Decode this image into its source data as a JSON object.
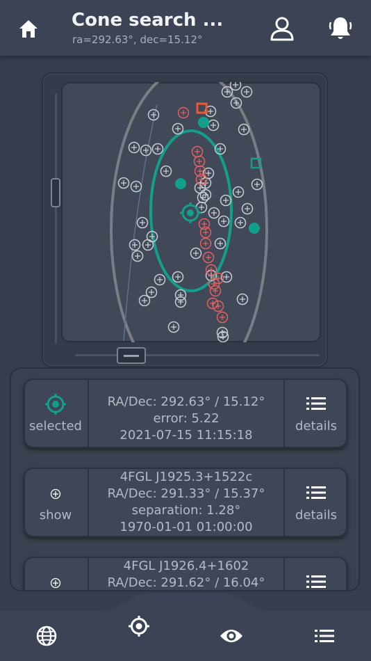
{
  "header": {
    "title": "Cone search ...",
    "subtitle": "ra=292.63°, dec=15.12°",
    "icons": [
      "home-icon",
      "user-icon",
      "bell-icon"
    ]
  },
  "colors": {
    "accent_teal": "#12a08d",
    "marker_red": "#e5605f",
    "marker_orange": "#f0582e",
    "marker_grey": "#c9ccd3",
    "background": "#363d4d"
  },
  "results": [
    {
      "left_label": "selected",
      "left_icon": "target-icon",
      "lines": [
        "RA/Dec: 292.63° / 15.12°",
        "error: 5.22",
        "2021-07-15  11:15:18"
      ],
      "right_label": "details",
      "right_icon": "list-icon"
    },
    {
      "left_label": "show",
      "left_icon": "crosshair-small-icon",
      "lines": [
        "4FGL J1925.3+1522c",
        "RA/Dec: 291.33° / 15.37°",
        "separation: 1.28°",
        "1970-01-01  01:00:00"
      ],
      "right_label": "details",
      "right_icon": "list-icon"
    },
    {
      "left_label": "",
      "left_icon": "crosshair-small-icon",
      "lines": [
        "4FGL J1926.4+1602",
        "RA/Dec: 291.62° / 16.04°"
      ],
      "right_label": "",
      "right_icon": "list-icon"
    }
  ],
  "bottom_nav": {
    "items": [
      "globe-icon",
      "target-icon",
      "eye-icon",
      "list-icon"
    ]
  }
}
